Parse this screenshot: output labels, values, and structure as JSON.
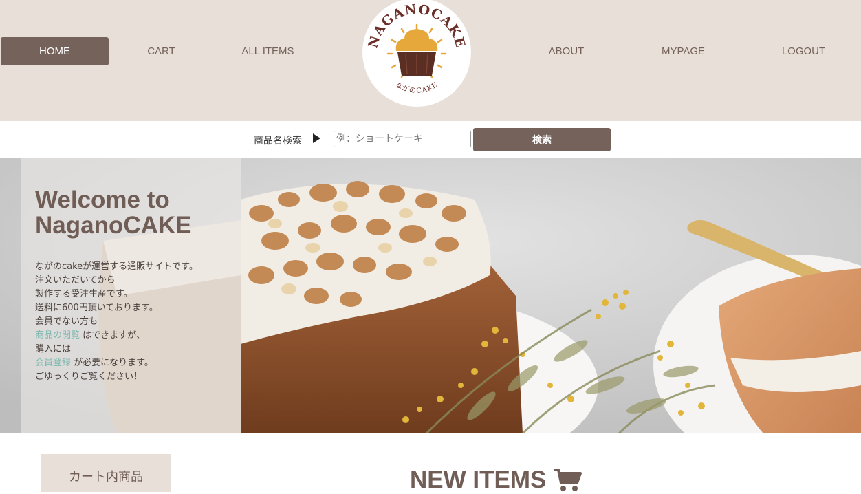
{
  "nav": {
    "home": "HOME",
    "cart": "CART",
    "all_items": "ALL ITEMS",
    "about": "ABOUT",
    "mypage": "MYPAGE",
    "logout": "LOGOUT",
    "active": "HOME"
  },
  "logo": {
    "arc_text": "NAGANOCAKE",
    "sub_text": "ながのCAKE",
    "icon": "cupcake-icon"
  },
  "search": {
    "label": "商品名検索",
    "arrow_icon": "play-arrow-icon",
    "placeholder": "例：ショートケーキ",
    "value": "",
    "button": "検索"
  },
  "hero": {
    "title_line1": "Welcome to",
    "title_line2": "NaganoCAKE",
    "lines": {
      "l1": "ながのcakeが運営する通販サイトです。",
      "l2": "注文いただいてから",
      "l3": "製作する受注生産です。",
      "l4": "送料に600円頂いております。",
      "l5": "会員でない方も",
      "l6_link": "商品の閲覧",
      "l6_rest": " はできますが、",
      "l7": "購入には",
      "l8_link": "会員登録",
      "l8_rest": " が必要になります。",
      "l9": "ごゆっくりご覧ください！"
    }
  },
  "sidebar": {
    "cart_title": "カート内商品"
  },
  "main": {
    "new_items": "NEW ITEMS",
    "new_items_icon": "shopping-cart-icon"
  },
  "colors": {
    "brand": "#75625a",
    "header_bg": "#e8dfd9",
    "link": "#7bb8b0"
  }
}
